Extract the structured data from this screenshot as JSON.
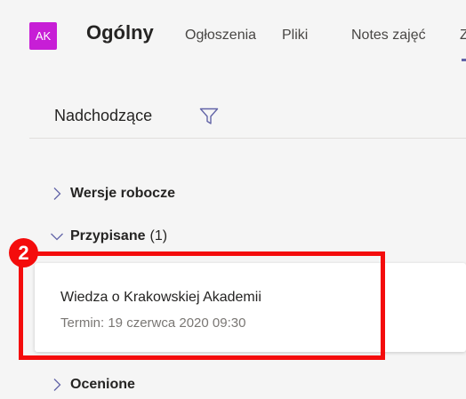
{
  "header": {
    "avatar_initials": "AK",
    "avatar_color": "#c71ed6",
    "channel_title": "Ogólny",
    "tabs": [
      {
        "label": "Ogłoszenia"
      },
      {
        "label": "Pliki"
      },
      {
        "label": "Notes zajęć"
      },
      {
        "label": "Z"
      }
    ],
    "active_tab_color": "#6264a7"
  },
  "panel": {
    "title": "Nadchodzące",
    "filter_icon": "filter-icon",
    "groups": {
      "drafts": {
        "label": "Wersje robocze",
        "icon": "chevron-right-icon"
      },
      "assigned": {
        "label": "Przypisane",
        "count": "(1)",
        "icon": "chevron-down-icon"
      },
      "graded": {
        "label": "Ocenione",
        "icon": "chevron-right-icon"
      }
    },
    "assignment": {
      "title": "Wiedza o Krakowskiej Akademii",
      "due": "Termin: 19 czerwca 2020 09:30"
    }
  },
  "callout": {
    "number": "2",
    "color": "#f40c0c"
  }
}
